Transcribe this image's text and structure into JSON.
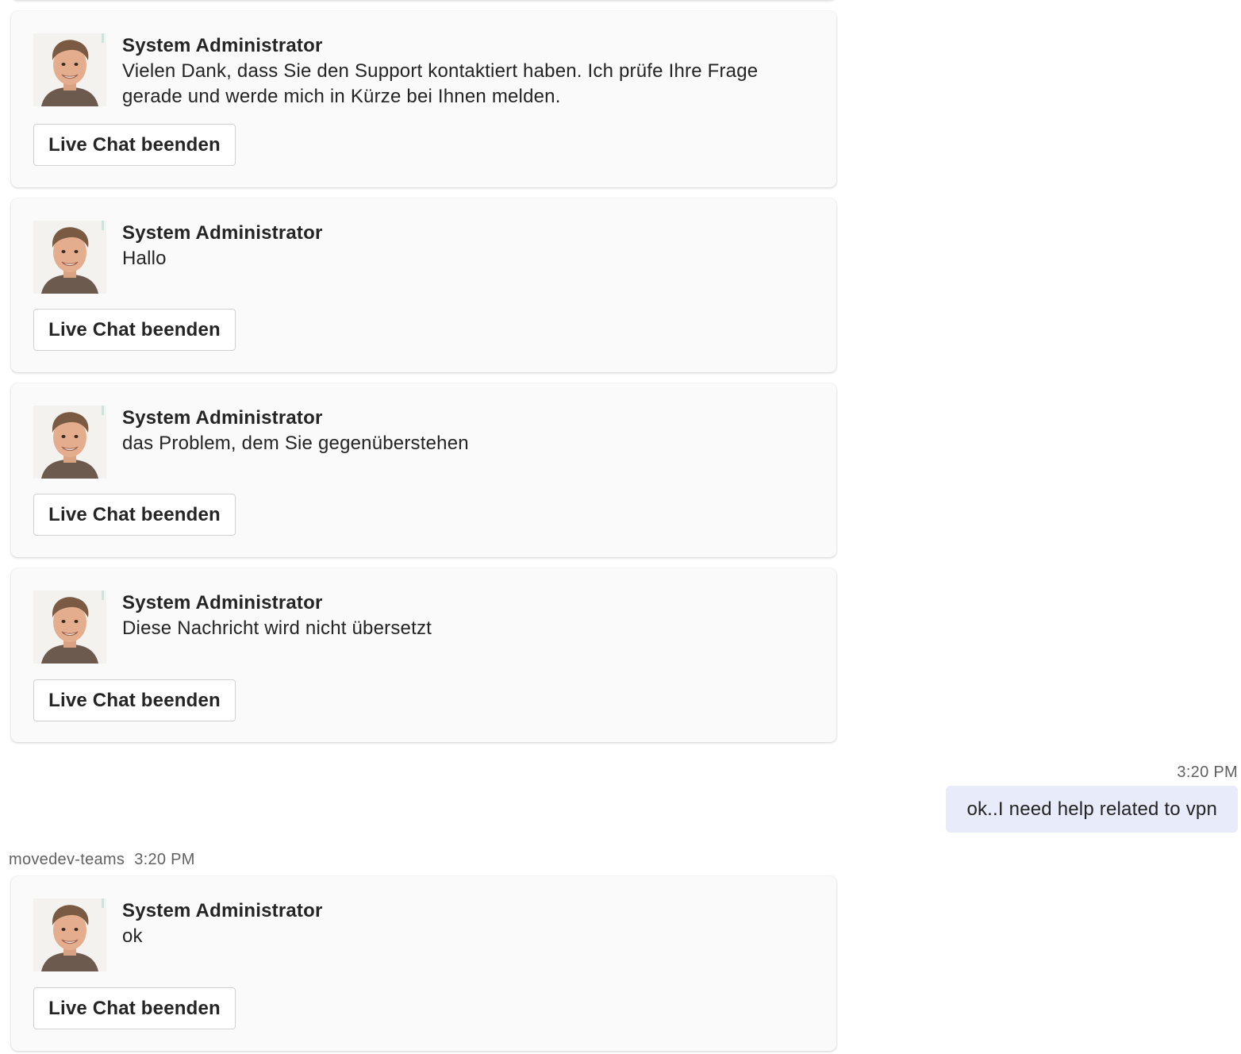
{
  "end_chat_label": "Live Chat beenden",
  "cards": [
    {
      "sender": "System Administrator",
      "message": "Vielen Dank, dass Sie den Support kontaktiert haben. Ich prüfe Ihre Frage gerade und werde mich in Kürze bei Ihnen melden."
    },
    {
      "sender": "System Administrator",
      "message": "Hallo"
    },
    {
      "sender": "System Administrator",
      "message": "das Problem, dem Sie gegenüberstehen"
    },
    {
      "sender": "System Administrator",
      "message": "Diese Nachricht wird nicht übersetzt"
    },
    {
      "sender": "System Administrator",
      "message": "ok"
    }
  ],
  "outgoing": {
    "time": "3:20 PM",
    "text": "ok..I need help related to vpn"
  },
  "incoming_meta": {
    "author": "movedev-teams",
    "time": "3:20 PM"
  },
  "colors": {
    "card_background": "#fafafa",
    "outgoing_bubble": "#e8ebfa",
    "muted_text": "#616161"
  }
}
